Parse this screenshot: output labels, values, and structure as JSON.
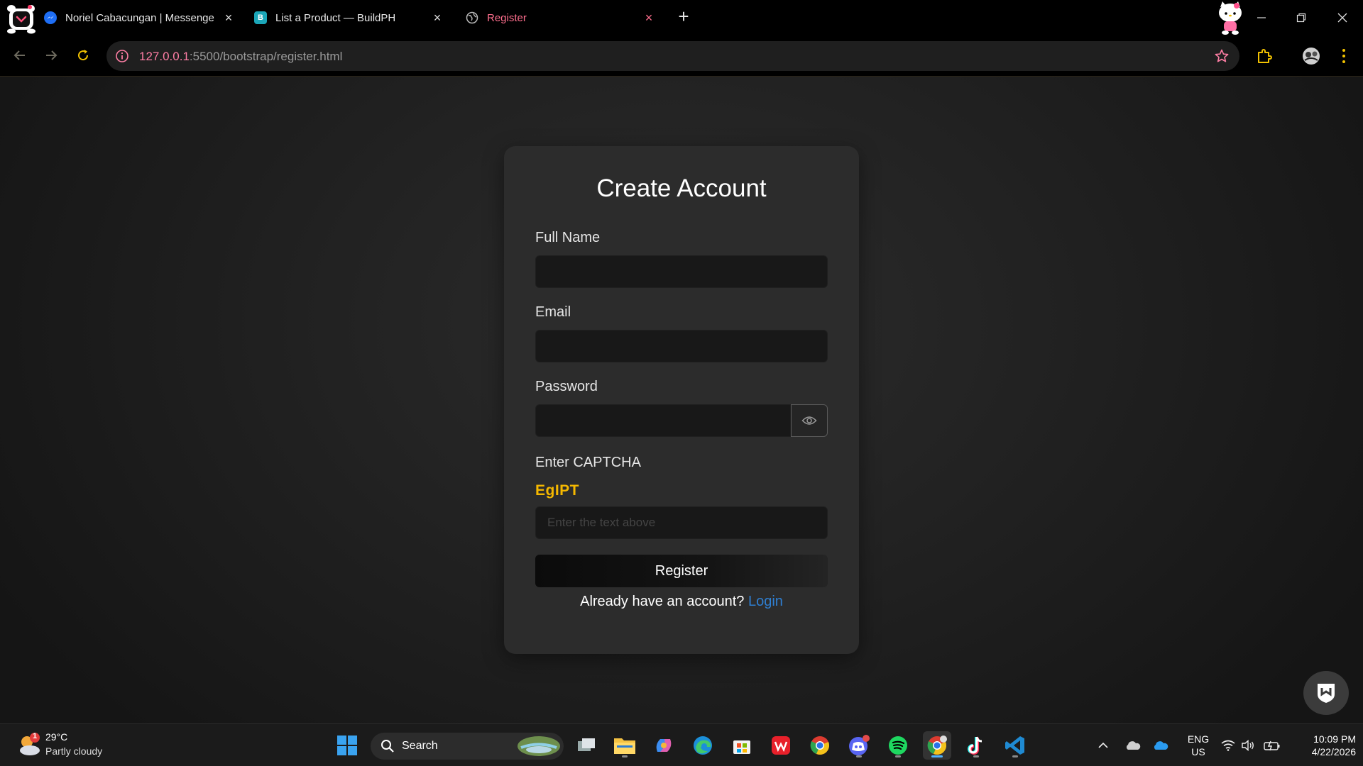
{
  "browser": {
    "tabs": [
      {
        "title": "Noriel Cabacungan | Messenger",
        "favicon_letter": ""
      },
      {
        "title": "List a Product — BuildPH",
        "favicon_letter": "B"
      },
      {
        "title": "Register",
        "favicon_letter": ""
      }
    ],
    "new_tab_label": "+",
    "close_label": "×",
    "url_host": "127.0.0.1",
    "url_path": ":5500/bootstrap/register.html",
    "colors": {
      "accent": "#ff6f8e",
      "host": "#ff7ea5"
    }
  },
  "form": {
    "title": "Create Account",
    "full_name_label": "Full Name",
    "full_name_value": "",
    "email_label": "Email",
    "email_value": "",
    "password_label": "Password",
    "password_value": "",
    "captcha_label": "Enter CAPTCHA",
    "captcha_code": "EgIPT",
    "captcha_placeholder": "Enter the text above",
    "register_label": "Register",
    "already_text": "Already have an account?",
    "login_link": "Login",
    "colors": {
      "captcha": "#f5b800",
      "link": "#2f7fd1",
      "card": "#2c2c2c"
    }
  },
  "taskbar": {
    "weather": {
      "badge": "1",
      "temp": "29°C",
      "condition": "Partly cloudy"
    },
    "search_label": "Search",
    "lang_top": "ENG",
    "lang_bottom": "US",
    "time": "10:09 PM",
    "date": "4/22/2026"
  }
}
